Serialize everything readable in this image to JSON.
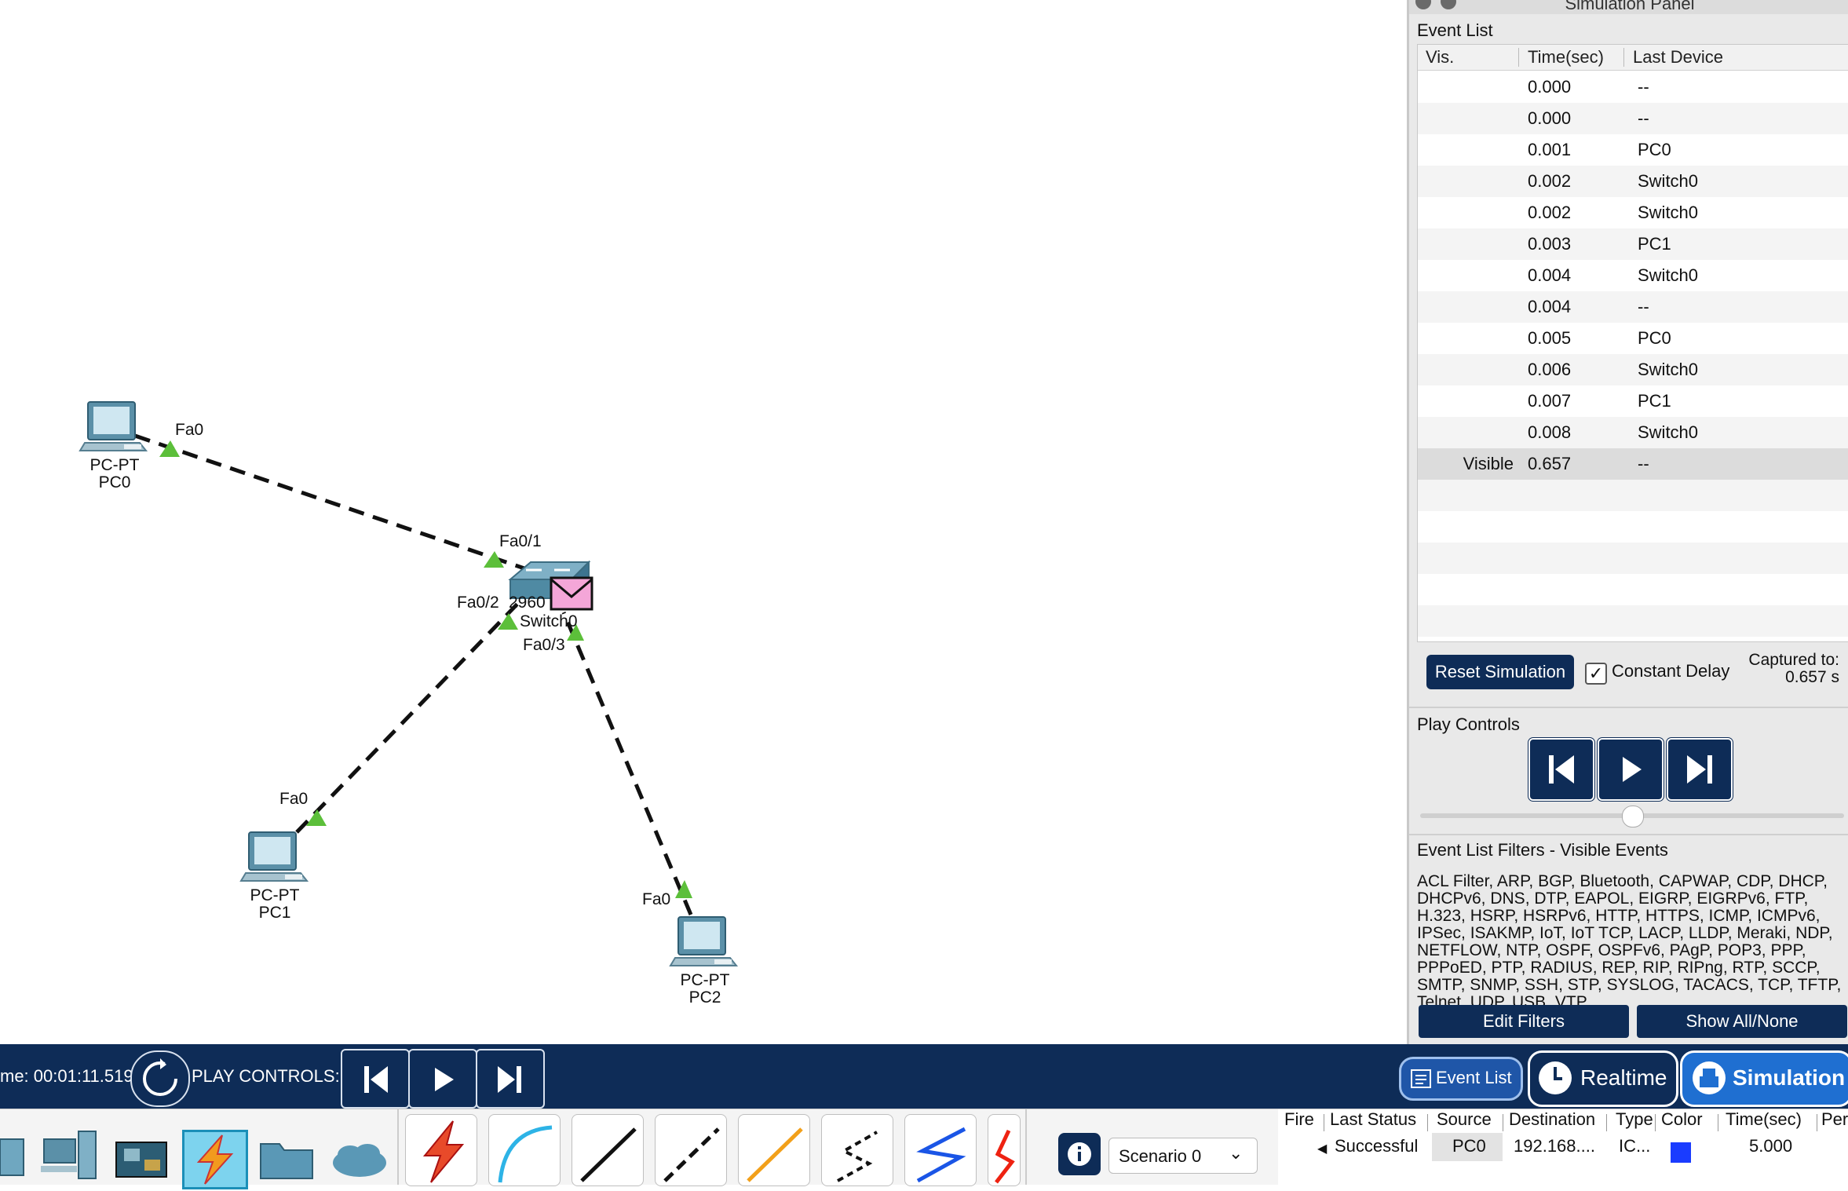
{
  "canvas": {
    "devices": [
      {
        "id": "pc0",
        "model": "PC-PT",
        "name": "PC0"
      },
      {
        "id": "pc1",
        "model": "PC-PT",
        "name": "PC1"
      },
      {
        "id": "pc2",
        "model": "PC-PT",
        "name": "PC2"
      },
      {
        "id": "switch0",
        "model": "2960",
        "name": "Switch0"
      }
    ],
    "ports": {
      "pc0_fa0": "Fa0",
      "sw_fa01": "Fa0/1",
      "sw_fa02": "Fa0/2",
      "sw_fa03": "Fa0/3",
      "pc1_fa0": "Fa0",
      "pc2_fa0": "Fa0"
    },
    "switch_model_text": "2960",
    "switch_name_text": "Switch0"
  },
  "sim_panel": {
    "title": "Simulation Panel",
    "event_list_label": "Event List",
    "columns": [
      "Vis.",
      "Time(sec)",
      "Last Device"
    ],
    "events": [
      {
        "vis": "",
        "time": "0.000",
        "device": "--"
      },
      {
        "vis": "",
        "time": "0.000",
        "device": "--"
      },
      {
        "vis": "",
        "time": "0.001",
        "device": "PC0"
      },
      {
        "vis": "",
        "time": "0.002",
        "device": "Switch0"
      },
      {
        "vis": "",
        "time": "0.002",
        "device": "Switch0"
      },
      {
        "vis": "",
        "time": "0.003",
        "device": "PC1"
      },
      {
        "vis": "",
        "time": "0.004",
        "device": "Switch0"
      },
      {
        "vis": "",
        "time": "0.004",
        "device": "--"
      },
      {
        "vis": "",
        "time": "0.005",
        "device": "PC0"
      },
      {
        "vis": "",
        "time": "0.006",
        "device": "Switch0"
      },
      {
        "vis": "",
        "time": "0.007",
        "device": "PC1"
      },
      {
        "vis": "",
        "time": "0.008",
        "device": "Switch0"
      },
      {
        "vis": "Visible",
        "time": "0.657",
        "device": "--"
      }
    ],
    "reset_label": "Reset Simulation",
    "constant_delay_label": "Constant Delay",
    "constant_delay_checked": true,
    "captured_label": "Captured to:",
    "captured_value": "0.657 s",
    "play_controls_label": "Play Controls",
    "playback_speed_fraction": 0.5,
    "filters_label": "Event List Filters - Visible Events",
    "filters_text": "ACL Filter, ARP, BGP, Bluetooth, CAPWAP, CDP, DHCP, DHCPv6, DNS, DTP, EAPOL, EIGRP, EIGRPv6, FTP, H.323, HSRP, HSRPv6, HTTP, HTTPS, ICMP, ICMPv6, IPSec, ISAKMP, IoT, IoT TCP, LACP, LLDP, Meraki, NDP, NETFLOW, NTP, OSPF, OSPFv6, PAgP, POP3, PPP, PPPoED, PTP, RADIUS, REP, RIP, RIPng, RTP, SCCP, SMTP, SNMP, SSH, STP, SYSLOG, TACACS, TCP, TFTP, Telnet, UDP, USB, VTP",
    "edit_filters_label": "Edit Filters",
    "show_all_label": "Show All/None"
  },
  "bottom_bar": {
    "time_text": "me: 00:01:11.519",
    "play_controls_label": "PLAY CONTROLS:",
    "event_list_label": "Event List",
    "realtime_label": "Realtime",
    "simulation_label": "Simulation"
  },
  "tray": {
    "scenario_label": "Scenario 0",
    "pdu_columns": [
      "Fire",
      "Last Status",
      "Source",
      "Destination",
      "Type",
      "Color",
      "Time(sec)",
      "Per"
    ],
    "pdu_row": {
      "fire": "",
      "last_status": "Successful",
      "source": "PC0",
      "destination": "192.168....",
      "type": "IC...",
      "color": "#1a3cff",
      "time": "5.000"
    }
  },
  "colors": {
    "accent": "#0e2c57",
    "link_dashed": "#111111",
    "port_up": "#5cbf3a",
    "pdu_envelope": "#f4a6d8"
  }
}
